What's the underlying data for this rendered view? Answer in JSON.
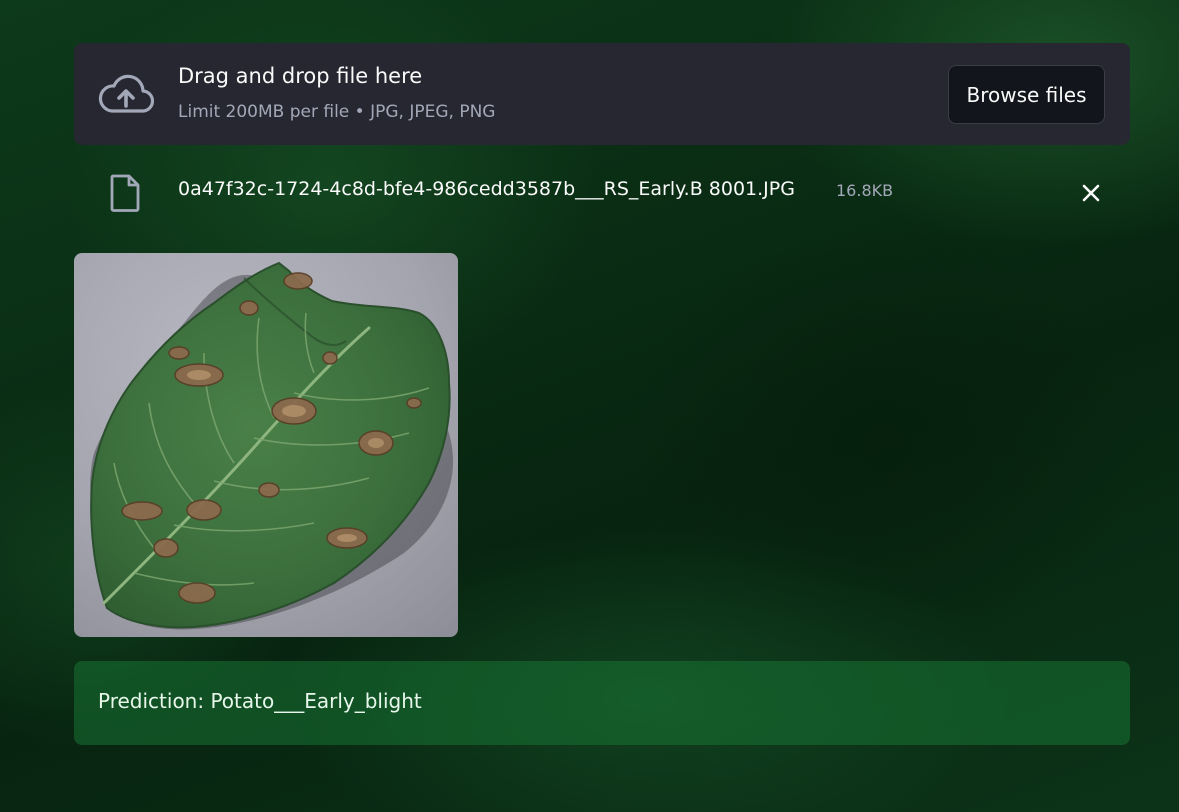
{
  "uploader": {
    "title": "Drag and drop file here",
    "limit_text": "Limit 200MB per file • JPG, JPEG, PNG",
    "browse_label": "Browse files",
    "icon": "cloud-upload-icon"
  },
  "uploaded_file": {
    "name": "0a47f32c-1724-4c8d-bfe4-986cedd3587b___RS_Early.B 8001.JPG",
    "size": "16.8KB",
    "icon": "file-icon",
    "remove_icon": "close-icon"
  },
  "preview": {
    "subject": "potato leaf with brown blight spots",
    "icon": "leaf-image"
  },
  "prediction": {
    "text": "Prediction: Potato___Early_blight"
  },
  "colors": {
    "uploader_bg": "#262730",
    "button_bg": "#13151c",
    "muted_text": "#a3a8b8",
    "prediction_bg": "#177233",
    "page_bg": "#0a2d14"
  }
}
